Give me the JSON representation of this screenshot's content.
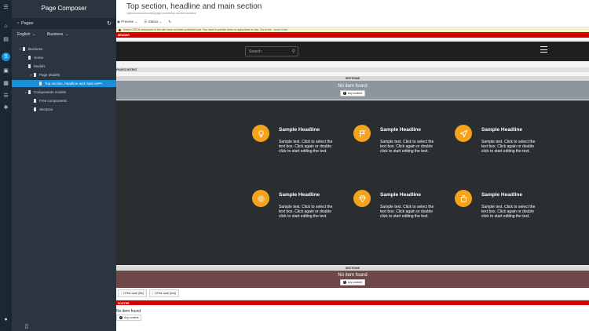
{
  "rail": {
    "icons": [
      "menu-icon",
      "home-icon",
      "book-icon",
      "site-icon",
      "image-icon",
      "table-icon",
      "list-icon",
      "tag-icon",
      "compass-icon"
    ],
    "bottom_icons": [
      "user-icon"
    ]
  },
  "composer": {
    "title": "Page Composer",
    "pages_label": "Pages",
    "language": "English",
    "site": "Business",
    "tree": [
      {
        "label": "Business",
        "depth": 0,
        "toggle": "v"
      },
      {
        "label": "Home",
        "depth": 1,
        "toggle": ""
      },
      {
        "label": "Models",
        "depth": 1,
        "toggle": ""
      },
      {
        "label": "Page Models",
        "depth": 2,
        "toggle": "v"
      },
      {
        "label": "Top section, headline and main se",
        "depth": 3,
        "toggle": "",
        "selected": true
      },
      {
        "label": "Components models",
        "depth": 1,
        "toggle": "v"
      },
      {
        "label": "Free components",
        "depth": 2,
        "toggle": ""
      },
      {
        "label": "Sections",
        "depth": 2,
        "toggle": ""
      }
    ]
  },
  "header": {
    "title": "Top section, headline and main section",
    "url": "/sites/business/models/page-models/top-section-headline",
    "preview_label": "Preview",
    "status_label": "Status"
  },
  "warning": {
    "text": "Some CSS/Js resources of the site have not been published yet. You have to publish them to apply them to live. Go to the",
    "link": "asset folder"
  },
  "labels": {
    "header": "HEADER",
    "pagecontent": "PAGECONTENT",
    "sections_top": "SECTIONS",
    "sections_bottom": "SECTIONS",
    "footer": "FOOTER",
    "no_item": "No item found",
    "any_content": "Any content",
    "search_placeholder": "Search",
    "html_code_file": "HTML code (file)",
    "html_code_text": "HTML code (text)"
  },
  "features": [
    {
      "icon": "lightbulb-icon",
      "headline": "Sample Headline",
      "text": "Sample text. Click to select the text box. Click again or double click to start editing the text."
    },
    {
      "icon": "flag-icon",
      "headline": "Sample Headline",
      "text": "Sample text. Click to select the text box. Click again or double click to start editing the text."
    },
    {
      "icon": "paper-plane-icon",
      "headline": "Sample Headline",
      "text": "Sample text. Click to select the text box. Click again or double click to start editing the text."
    },
    {
      "icon": "gear-icon",
      "headline": "Sample Headline",
      "text": "Sample text. Click to select the text box. Click again or double click to start editing the text."
    },
    {
      "icon": "diamond-icon",
      "headline": "Sample Headline",
      "text": "Sample text. Click to select the text box. Click again or double click to start editing the text."
    },
    {
      "icon": "bag-icon",
      "headline": "Sample Headline",
      "text": "Sample text. Click to select the text box. Click again or double click to start editing the text."
    }
  ],
  "colors": {
    "accent": "#1a8fd8",
    "feature_icon": "#f5a21c",
    "red_bar": "#d40000",
    "section_top_bg": "#8e959d",
    "section_bottom_bg": "#6e4848"
  }
}
